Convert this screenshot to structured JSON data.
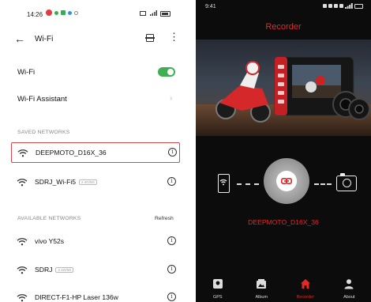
{
  "left_screen": {
    "status": {
      "time": "14:26"
    },
    "header": {
      "title": "Wi-Fi"
    },
    "wifi_toggle": {
      "label": "Wi-Fi",
      "on": true
    },
    "assistant": {
      "label": "Wi-Fi Assistant"
    },
    "saved_networks": {
      "heading": "SAVED NETWORKS",
      "items": [
        {
          "name": "DEEPMOTO_D16X_36",
          "tag": "",
          "selected": true
        },
        {
          "name": "SDRJ_Wi-Fi5",
          "tag": "2.4G/5G",
          "selected": false
        }
      ]
    },
    "available_networks": {
      "heading": "AVAILABLE NETWORKS",
      "refresh_label": "Refresh",
      "items": [
        {
          "name": "vivo Y52s",
          "tag": ""
        },
        {
          "name": "SDRJ",
          "tag": "2.4G/5G"
        },
        {
          "name": "DIRECT-F1-HP Laser 136w",
          "tag": ""
        }
      ]
    }
  },
  "right_screen": {
    "status": {
      "time": "9:41"
    },
    "title": "Recorder",
    "device_name": "DEEPMOTO_D16X_36",
    "tabs": [
      {
        "label": "GPS",
        "icon": "map-pin-icon",
        "active": false
      },
      {
        "label": "Album",
        "icon": "album-icon",
        "active": false
      },
      {
        "label": "Recorder",
        "icon": "home-icon",
        "active": true
      },
      {
        "label": "About",
        "icon": "person-icon",
        "active": false
      }
    ]
  },
  "colors": {
    "accent_red": "#e02a2a",
    "toggle_green": "#3fae55",
    "selected_border": "#d9474e"
  }
}
